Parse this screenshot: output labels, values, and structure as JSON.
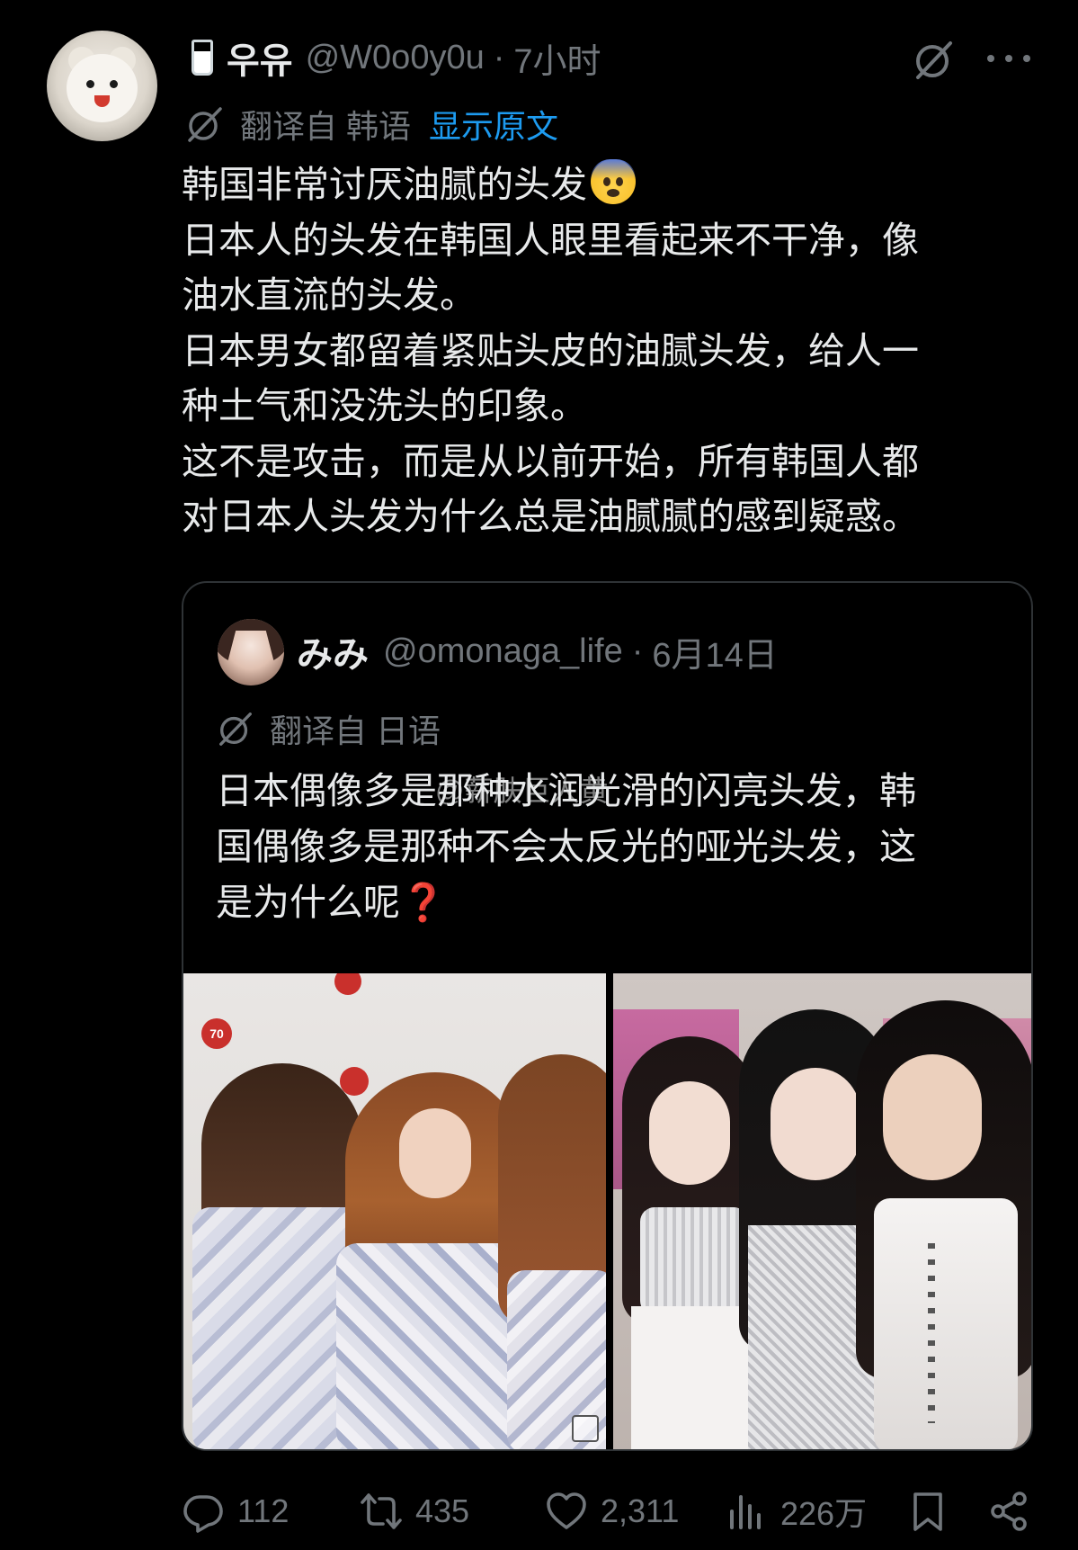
{
  "tweet": {
    "author": {
      "display_name": "우유",
      "handle": "@W0o0y0u",
      "separator": "·",
      "time": "7小时"
    },
    "translation": {
      "label": "翻译自 韩语",
      "show_original": "显示原文"
    },
    "lines": [
      "韩国非常讨厌油腻的头发",
      "日本人的头发在韩国人眼里看起来不干净，像",
      "油水直流的头发。",
      "日本男女都留着紧贴头皮的油腻头发，给人一",
      "种土气和没洗头的印象。",
      "这不是攻击，而是从以前开始，所有韩国人都",
      "对日本人头发为什么总是油腻腻的感到疑惑。"
    ],
    "emoji": "fearful-face"
  },
  "quote": {
    "author": {
      "display_name": "みみ",
      "handle": "@omonaga_life",
      "separator": "·",
      "time": "6月14日"
    },
    "translation": {
      "label": "翻译自 日语"
    },
    "lines": [
      "日本偶像多是那种水润光滑的闪亮头发，韩",
      "国偶像多是那种不会太反光的哑光头发，这",
      "是为什么呢"
    ],
    "question_mark": "❓",
    "watermark": "@薪肤巨人黄",
    "media": [
      {
        "alt": "photo-japanese-idols",
        "badge": "70"
      },
      {
        "alt": "photo-korean-idols"
      }
    ]
  },
  "actions": {
    "replies": "112",
    "reposts": "435",
    "likes": "2,311",
    "views": "226万"
  },
  "colors": {
    "background": "#000000",
    "text": "#e7e9ea",
    "muted": "#71767b",
    "link": "#1d9bf0",
    "border": "#2f3336"
  }
}
